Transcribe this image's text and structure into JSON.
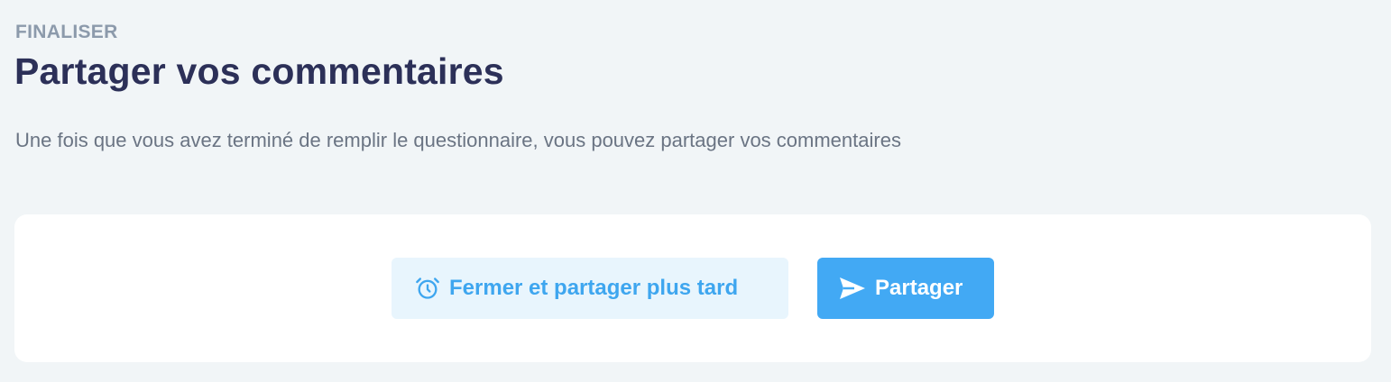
{
  "section": {
    "eyebrow": "FINALISER",
    "title": "Partager vos commentaires",
    "subtitle": "Une fois que vous avez terminé de remplir le questionnaire, vous pouvez partager vos commentaires"
  },
  "actions": {
    "later": {
      "label": "Fermer et partager plus tard",
      "icon": "alarm-clock-icon"
    },
    "share": {
      "label": "Partager",
      "icon": "send-icon"
    }
  },
  "colors": {
    "background": "#f1f5f7",
    "title": "#2c3058",
    "eyebrow": "#8c9aab",
    "accent": "#42a9f4",
    "secondary_button_bg": "#e8f5fd"
  }
}
